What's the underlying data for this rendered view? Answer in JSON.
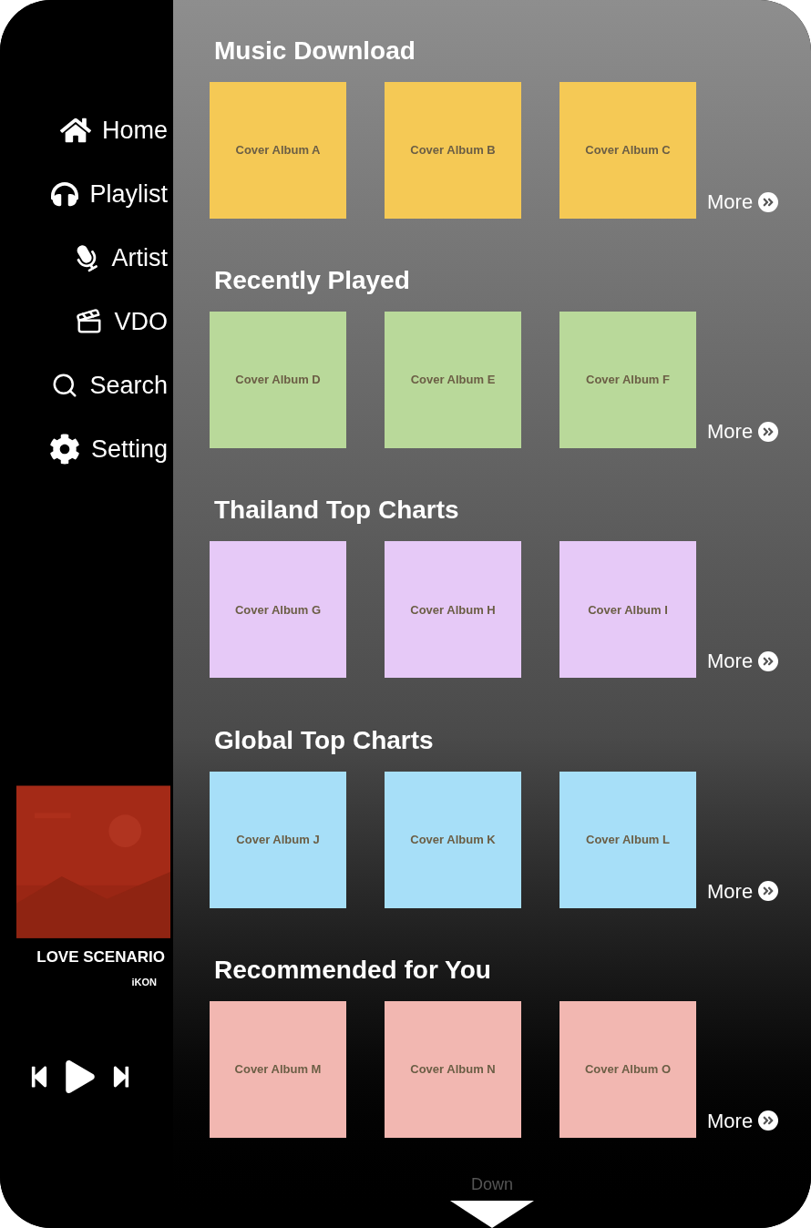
{
  "sidebar": {
    "items": [
      {
        "label": "Home"
      },
      {
        "label": "Playlist"
      },
      {
        "label": "Artist"
      },
      {
        "label": "VDO"
      },
      {
        "label": "Search"
      },
      {
        "label": "Setting"
      }
    ]
  },
  "now_playing": {
    "title": "LOVE SCENARIO",
    "artist": "iKON"
  },
  "sections": [
    {
      "title": "Music Download",
      "color": "#f5c955",
      "albums": [
        "Cover Album A",
        "Cover Album B",
        "Cover Album C"
      ],
      "more": "More"
    },
    {
      "title": "Recently Played",
      "color": "#b9d99a",
      "albums": [
        "Cover Album D",
        "Cover Album E",
        "Cover Album F"
      ],
      "more": "More"
    },
    {
      "title": "Thailand Top Charts",
      "color": "#e6c9f7",
      "albums": [
        "Cover Album G",
        "Cover Album H",
        "Cover Album I"
      ],
      "more": "More"
    },
    {
      "title": "Global Top Charts",
      "color": "#a7dff8",
      "albums": [
        "Cover Album J",
        "Cover Album K",
        "Cover Album L"
      ],
      "more": "More"
    },
    {
      "title": "Recommended for You",
      "color": "#f2b7b1",
      "albums": [
        "Cover Album M",
        "Cover Album N",
        "Cover Album O"
      ],
      "more": "More"
    }
  ],
  "scroll_hint": "Down"
}
